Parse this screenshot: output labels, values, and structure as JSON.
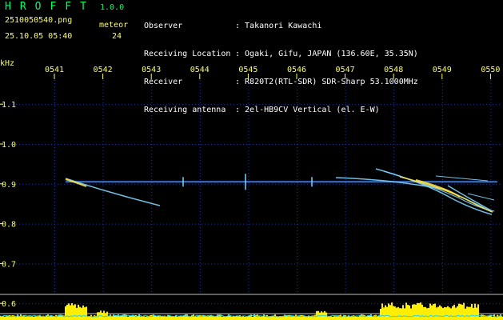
{
  "header": {
    "app_name": "HROFFT",
    "app_version": "1.0.0",
    "filename": "2510050540.png",
    "meteor_label": "meteor",
    "datetime": "25.10.05 05:40",
    "meteor_count": "24"
  },
  "info": [
    {
      "label": "Observer",
      "value": ": Takanori Kawachi"
    },
    {
      "label": "Receiving Location",
      "value": ": Ogaki, Gifu, JAPAN (136.60E, 35.35N)"
    },
    {
      "label": "Receiver",
      "value": ": R820T2(RTL-SDR) SDR-Sharp 53.1000MHz"
    },
    {
      "label": "Receiving antenna",
      "value": ": 2el-HB9CV Vertical (el. E-W)"
    }
  ],
  "spectrogram": {
    "y_unit_label": "kHz",
    "time_labels": [
      "0541",
      "0542",
      "0543",
      "0544",
      "0545",
      "0546",
      "0547",
      "0548",
      "0549",
      "0550"
    ],
    "freq_labels": [
      "1.1",
      "1.0",
      "0.9",
      "0.8",
      "0.7",
      "0.6"
    ],
    "freq_values": [
      1.1,
      1.0,
      0.9,
      0.8,
      0.7,
      0.6
    ],
    "carrier_khz": 0.905,
    "colors": {
      "background": "#000000",
      "grid_dots": "#1e3a8a",
      "carrier": "#3b82f6",
      "meteor_trace": "#7dd3fc",
      "meteor_hot": "#fde047",
      "level_fill": "#ffee00",
      "level_line": "#22d3ee",
      "border": "#c0c0c0"
    }
  }
}
